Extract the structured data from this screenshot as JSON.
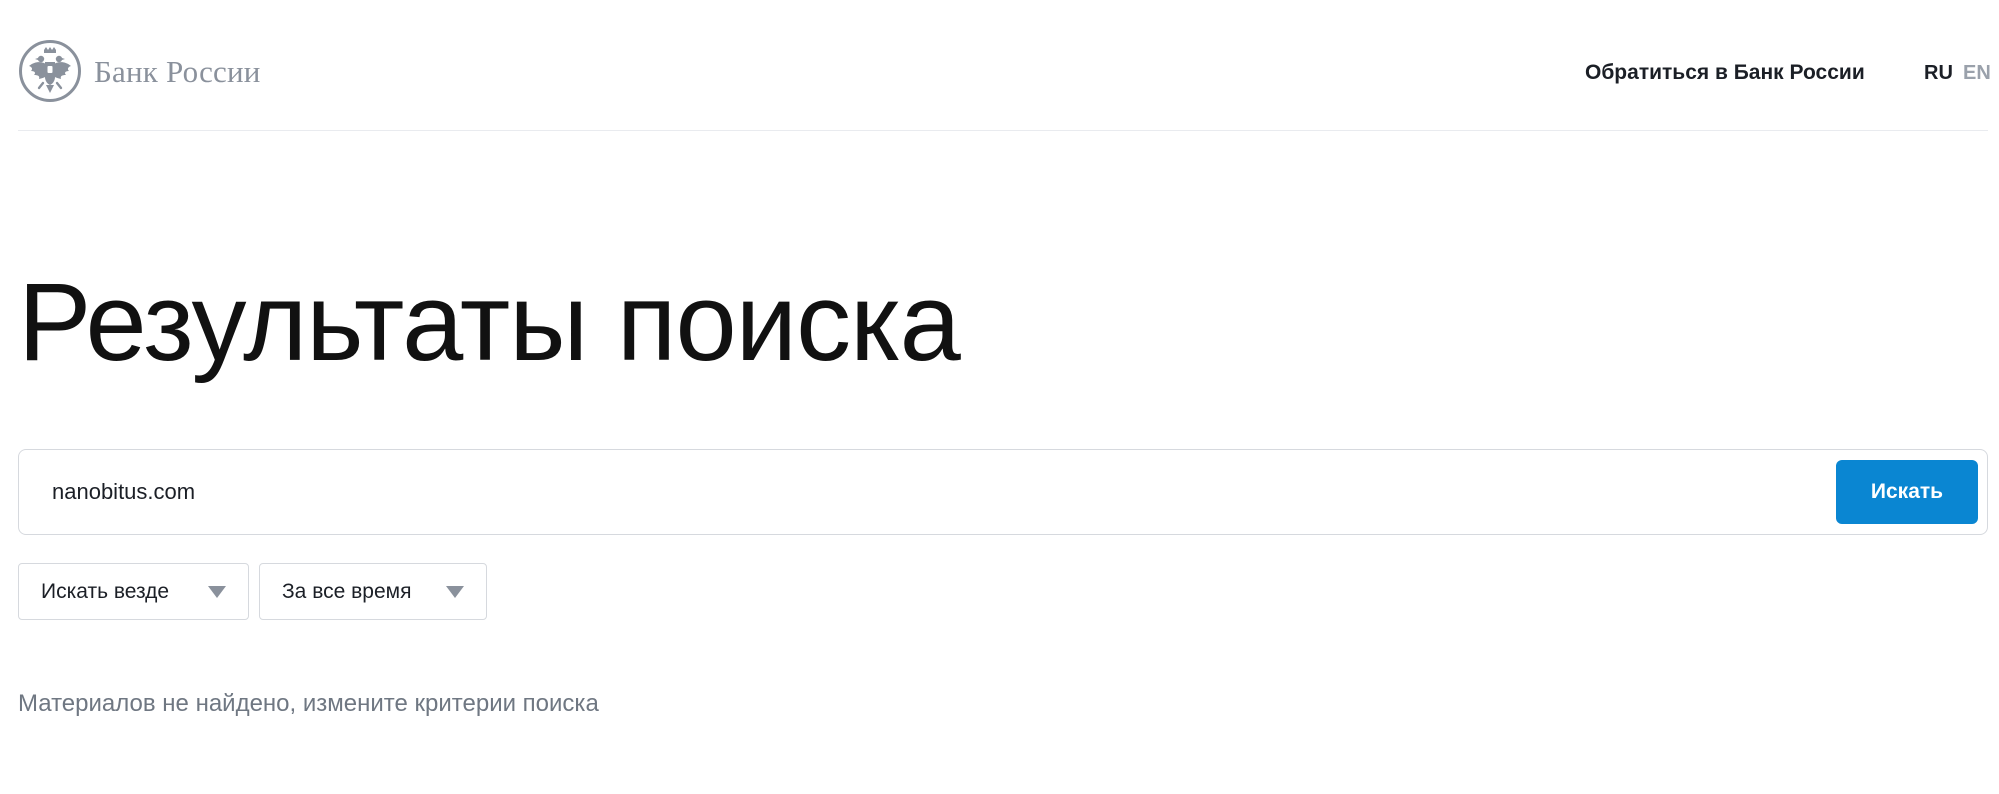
{
  "header": {
    "logo_text": "Банк России",
    "contact_link": "Обратиться в Банк России",
    "languages": {
      "ru": "RU",
      "en": "EN",
      "active": "RU"
    }
  },
  "main": {
    "title": "Результаты поиска",
    "search": {
      "value": "nanobitus.com",
      "button_label": "Искать"
    },
    "filters": {
      "where": "Искать везде",
      "period": "За все время"
    },
    "empty_message": "Материалов не найдено, измените критерии поиска"
  },
  "colors": {
    "accent": "#0a86d2",
    "muted_text": "#6f7782",
    "logo_grey": "#8a919c",
    "border": "#d6d9de"
  },
  "icons": {
    "logo": "double-headed-eagle-icon",
    "dropdown": "triangle-down-icon"
  }
}
